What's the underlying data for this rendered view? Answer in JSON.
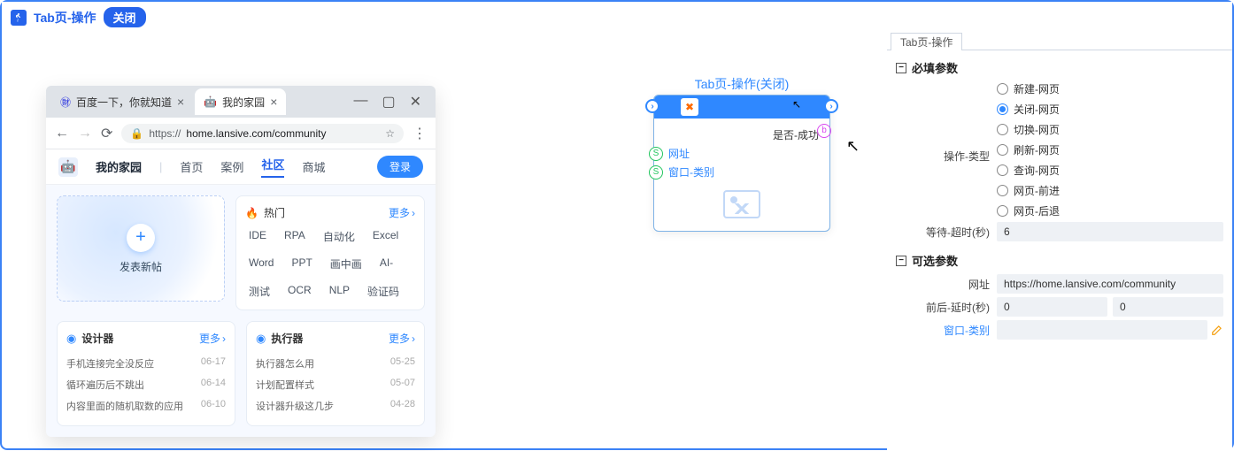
{
  "topbar": {
    "title": "Tab页-操作",
    "pill": "关闭"
  },
  "browser": {
    "tabs": [
      {
        "title": "百度一下，你就知道"
      },
      {
        "title": "我的家园"
      }
    ],
    "url_prefix": "https://",
    "url_rest": "home.lansive.com/community",
    "site_name": "我的家园",
    "nav": {
      "home": "首页",
      "cases": "案例",
      "community": "社区",
      "mall": "商城"
    },
    "login": "登录",
    "new_post": "发表新帖",
    "hot": {
      "title": "热门",
      "more": "更多"
    },
    "tags": [
      "IDE",
      "RPA",
      "自动化",
      "Excel",
      "Word",
      "PPT",
      "画中画",
      "AI-",
      "测试",
      "OCR",
      "NLP",
      "验证码"
    ],
    "designer": {
      "title": "设计器",
      "more": "更多",
      "items": [
        {
          "t": "手机连接完全没反应",
          "d": "06-17"
        },
        {
          "t": "循环遍历后不跳出",
          "d": "06-14"
        },
        {
          "t": "内容里面的随机取数的应用",
          "d": "06-10"
        }
      ]
    },
    "executor": {
      "title": "执行器",
      "more": "更多",
      "items": [
        {
          "t": "执行器怎么用",
          "d": "05-25"
        },
        {
          "t": "计划配置样式",
          "d": "05-07"
        },
        {
          "t": "设计器升级这几步",
          "d": "04-28"
        }
      ]
    }
  },
  "node": {
    "title": "Tab页-操作(关闭)",
    "out": "是否-成功",
    "in1": "网址",
    "in2": "窗口-类别"
  },
  "panel": {
    "tab": "Tab页-操作",
    "required": "必填参数",
    "optional": "可选参数",
    "op_type_label": "操作-类型",
    "ops": {
      "new": "新建-网页",
      "close": "关闭-网页",
      "switch": "切换-网页",
      "refresh": "刷新-网页",
      "query": "查询-网页",
      "forward": "网页-前进",
      "back": "网页-后退"
    },
    "timeout_label": "等待-超时(秒)",
    "timeout_value": "6",
    "url_label": "网址",
    "url_value": "https://home.lansive.com/community",
    "delay_label": "前后-延时(秒)",
    "delay_before": "0",
    "delay_after": "0",
    "window_label": "窗口-类别"
  }
}
